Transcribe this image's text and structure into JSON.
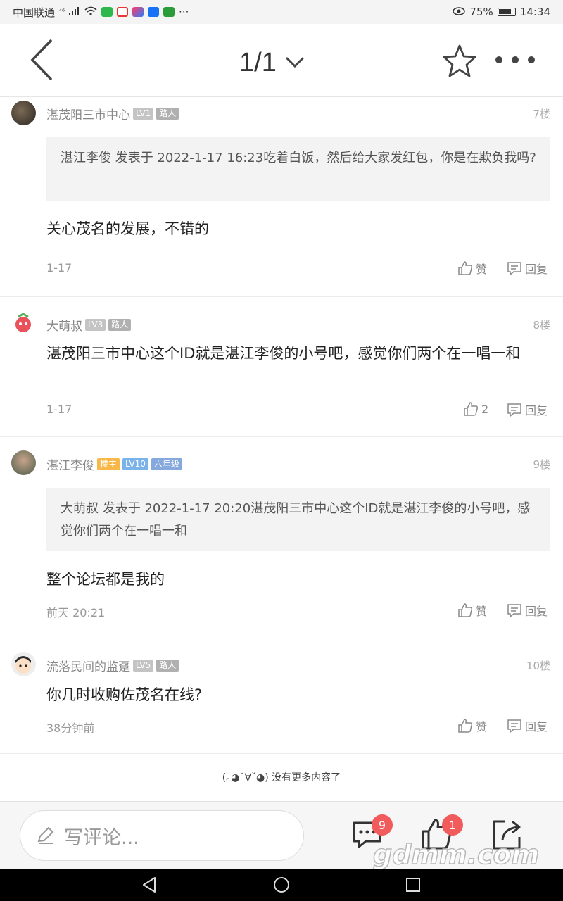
{
  "status_bar": {
    "carrier": "中国联通",
    "network": "⁴⁶",
    "battery": "75%",
    "time": "14:34"
  },
  "header": {
    "page_indicator": "1/1"
  },
  "comments": [
    {
      "username": "湛茂阳三市中心",
      "badges": [
        "LV1",
        "路人"
      ],
      "floor": "7楼",
      "quote": "湛江李俊 发表于 2022-1-17 16:23吃着白饭，然后给大家发红包，你是在欺负我吗?",
      "text": "关心茂名的发展，不错的",
      "time": "1-17",
      "like_label": "赞",
      "reply_label": "回复"
    },
    {
      "username": "大萌叔",
      "badges": [
        "LV3",
        "路人"
      ],
      "floor": "8楼",
      "text": "湛茂阳三市中心这个ID就是湛江李俊的小号吧，感觉你们两个在一唱一和",
      "time": "1-17",
      "like_label": "2",
      "reply_label": "回复"
    },
    {
      "username": "湛江李俊",
      "badges": [
        "楼主",
        "LV10",
        "六年级"
      ],
      "floor": "9楼",
      "quote": "大萌叔 发表于 2022-1-17 20:20湛茂阳三市中心这个ID就是湛江李俊的小号吧，感觉你们两个在一唱一和",
      "text": "整个论坛都是我的",
      "time": "前天 20:21",
      "like_label": "赞",
      "reply_label": "回复"
    },
    {
      "username": "流落民间的监趸",
      "badges": [
        "LV5",
        "路人"
      ],
      "floor": "10楼",
      "text": "你几时收购佐茂名在线?",
      "time": "38分钟前",
      "like_label": "赞",
      "reply_label": "回复"
    }
  ],
  "footer_note": "(｡◕ˇ∀ˇ◕) 没有更多内容了",
  "bottom_bar": {
    "input_placeholder": "写评论...",
    "comment_count": "9",
    "like_count": "1"
  },
  "watermark": "gdmm.com",
  "colors": {
    "badge_red": "#f15b5b",
    "badge_owner": "#f7b847",
    "badge_level_blue": "#7ab2ea"
  }
}
